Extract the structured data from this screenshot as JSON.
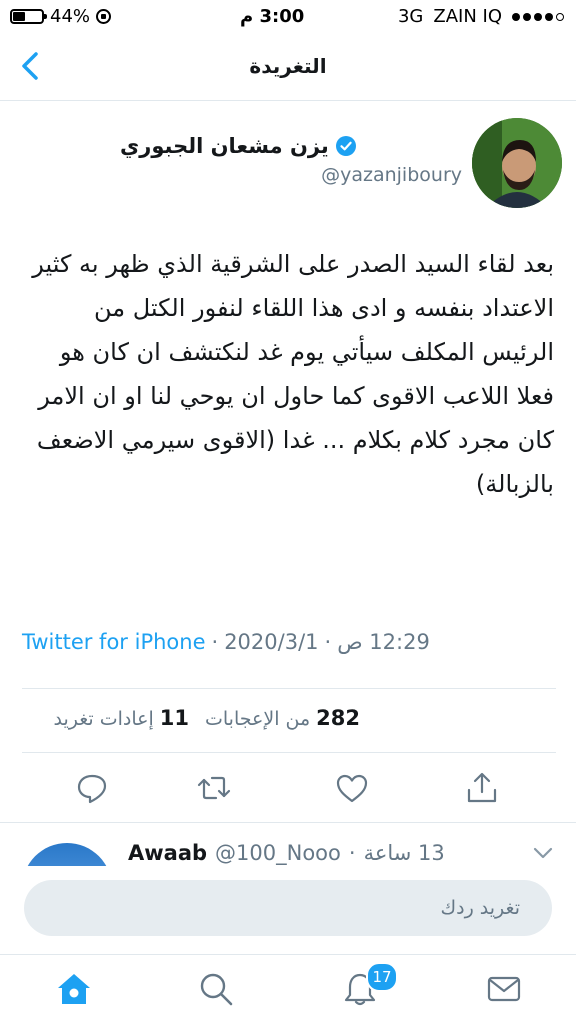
{
  "status_bar": {
    "battery": "44%",
    "time": "3:00 م",
    "network": "3G",
    "carrier": "ZAIN IQ",
    "signal_level": 0.8
  },
  "nav": {
    "title": "التغريدة",
    "back_icon": "chevron-left-icon"
  },
  "tweet": {
    "author_name": "يزن مشعان الجبوري",
    "handle": "@yazanjiboury",
    "verified": true,
    "text": "بعد لقاء السيد الصدر على الشرقية الذي ظهر به كثير الاعتداد بنفسه و ادى هذا اللقاء لنفور الكتل من الرئيس المكلف سيأتي يوم غد لنكتشف ان كان هو فعلا اللاعب الاقوى كما حاول ان يوحي لنا او ان الامر كان مجرد كلام بكلام ... غدا (الاقوى سيرمي الاضعف بالزبالة)",
    "time": "12:29 ص",
    "separator": "·",
    "date": "2020/3/1",
    "source": "Twitter for iPhone",
    "likes_count": "282",
    "likes_label": "من الإعجابات",
    "retweets_count": "11",
    "retweets_label": "إعادات تغريد"
  },
  "actions": [
    "reply-icon",
    "retweet-icon",
    "like-icon",
    "share-icon"
  ],
  "reply_preview": {
    "name": "Awaab",
    "handle": "@100_Nooo",
    "separator": "·",
    "time": "13 ساعة"
  },
  "reply_bar": {
    "placeholder": "تغريد ردك"
  },
  "tab_bar": {
    "items": [
      "home-icon",
      "search-icon",
      "notifications-icon",
      "messages-icon"
    ],
    "notifications_badge": "17"
  },
  "colors": {
    "accent": "#1da1f2",
    "secondary_text": "#657786",
    "input_bg": "#e6ecf0"
  }
}
